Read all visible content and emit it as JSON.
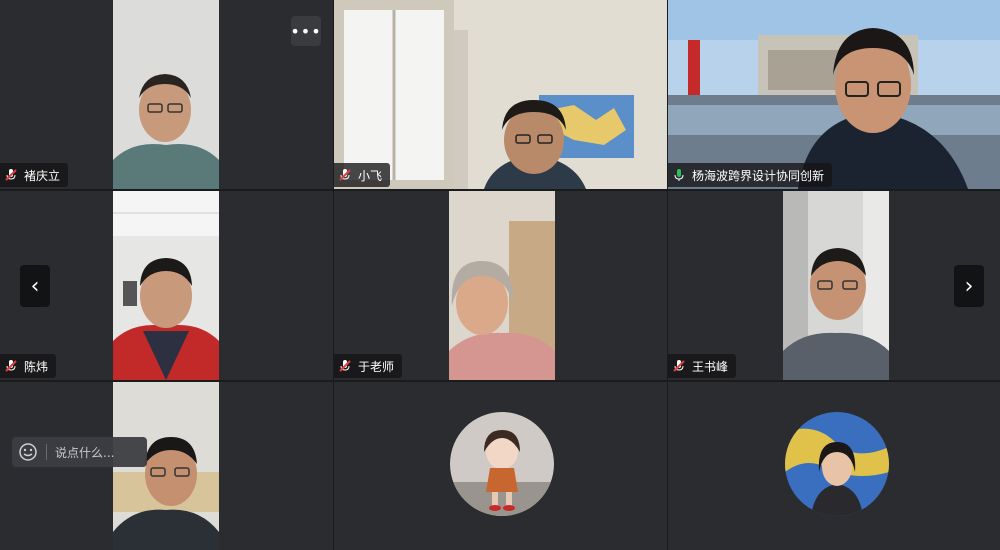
{
  "participants": [
    {
      "name": "褚庆立",
      "mic": "muted"
    },
    {
      "name": "小飞",
      "mic": "muted"
    },
    {
      "name": "杨海波跨界设计协同创新",
      "mic": "active",
      "speaking": true
    },
    {
      "name": "陈炜",
      "mic": "muted"
    },
    {
      "name": "于老师",
      "mic": "muted"
    },
    {
      "name": "王书峰",
      "mic": "muted"
    }
  ],
  "controls": {
    "more_label": "•••",
    "prev_label": "‹",
    "next_label": "›"
  },
  "chat": {
    "placeholder": "说点什么..."
  },
  "colors": {
    "active_border": "#2fbf5a",
    "muted_mic": "#e04040",
    "tile_bg": "#2b2c2f"
  }
}
